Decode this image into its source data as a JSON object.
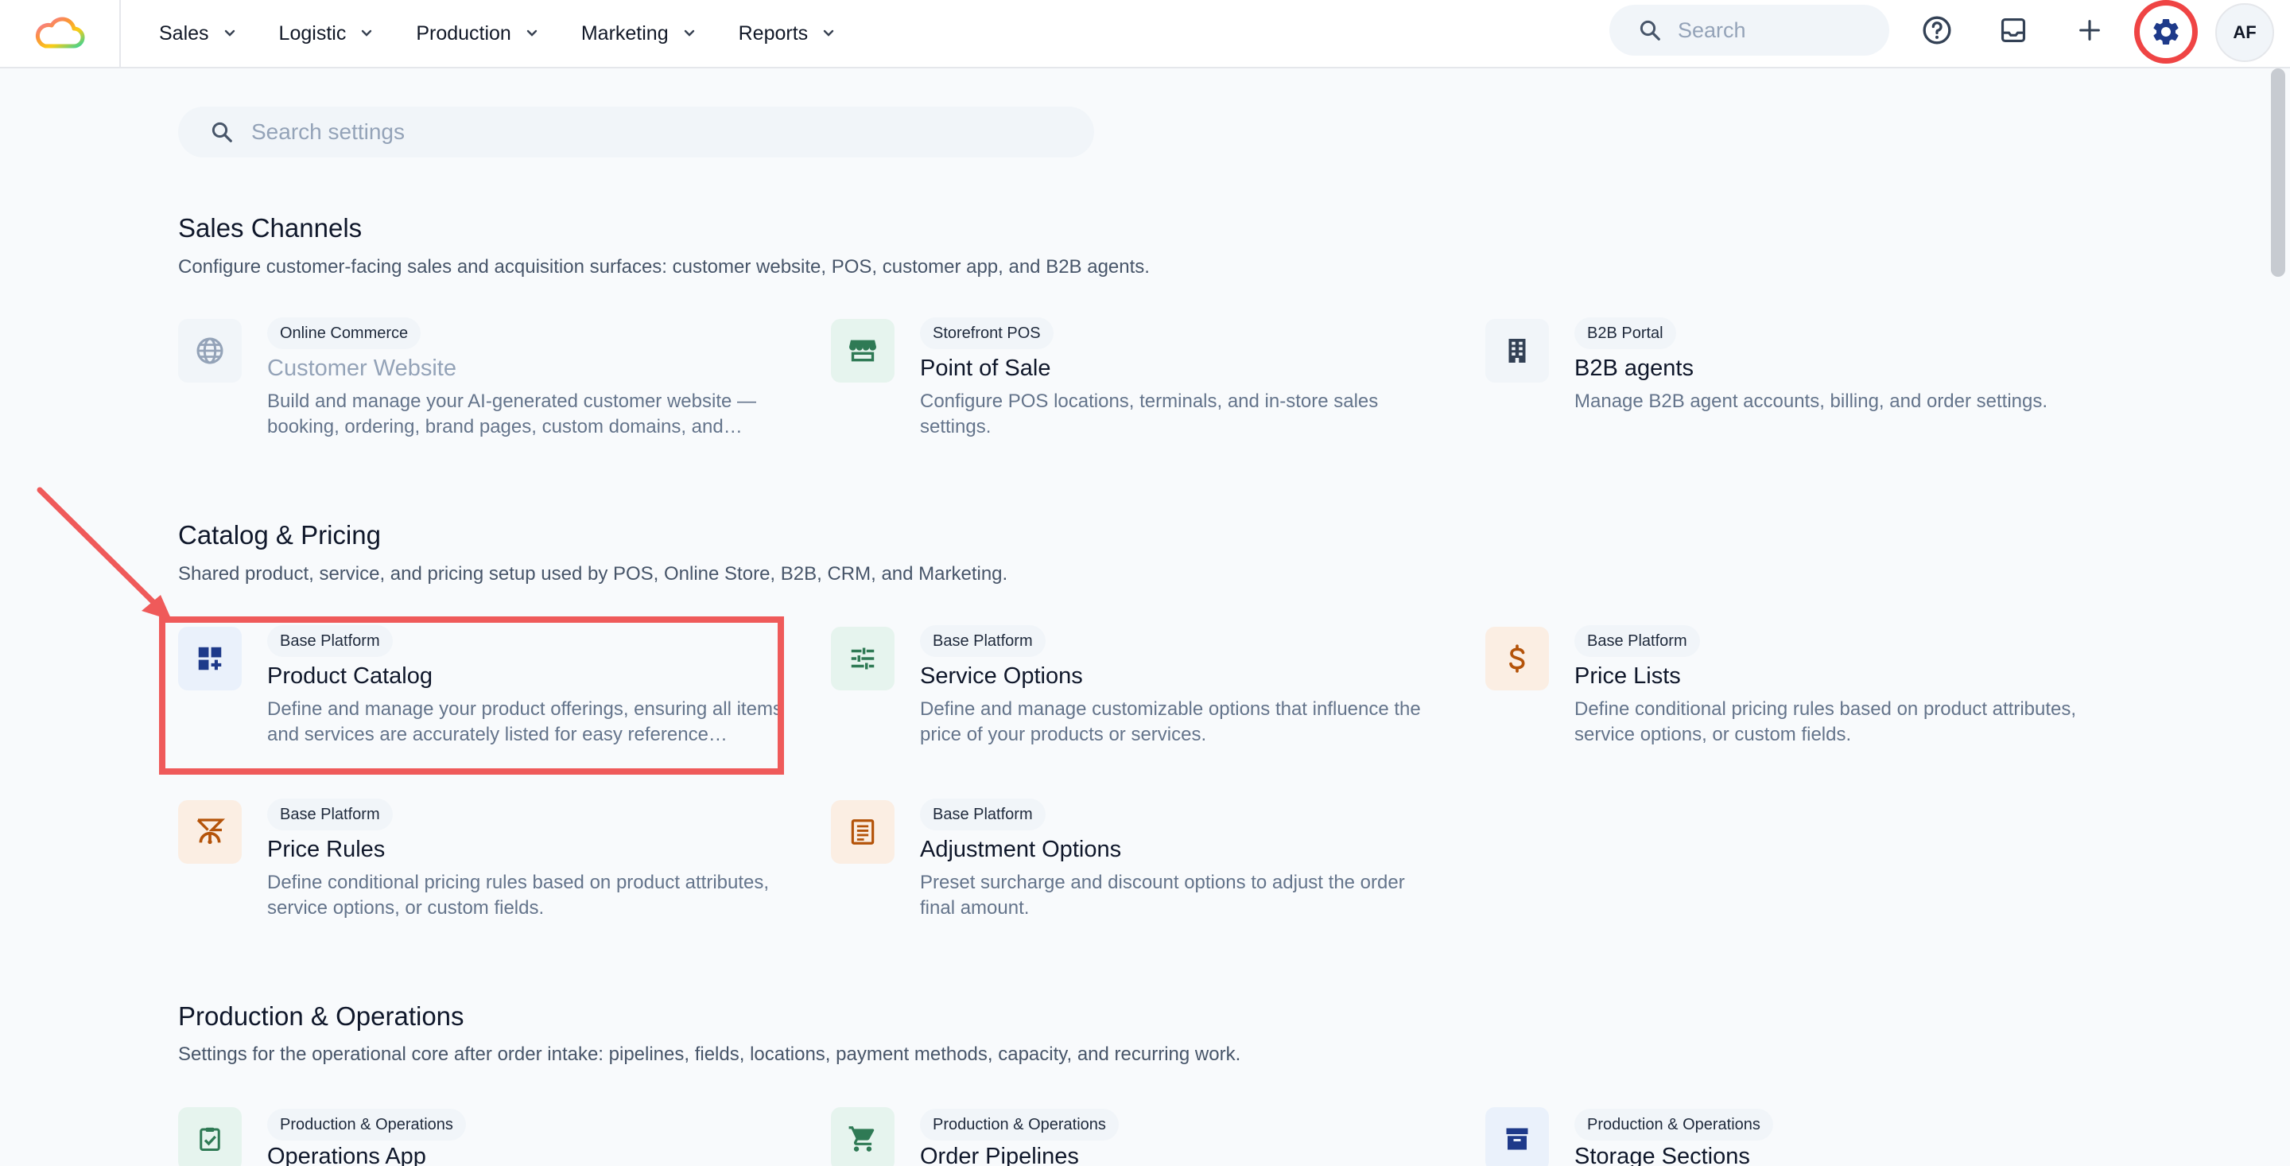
{
  "brand": {
    "logo_name": "cloud-logo"
  },
  "nav": {
    "items": [
      {
        "label": "Sales"
      },
      {
        "label": "Logistic"
      },
      {
        "label": "Production"
      },
      {
        "label": "Marketing"
      },
      {
        "label": "Reports"
      }
    ]
  },
  "header": {
    "search_placeholder": "Search",
    "avatar_initials": "AF",
    "icons": [
      "help-circle-icon",
      "inbox-icon",
      "plus-icon",
      "gear-icon"
    ]
  },
  "settings_search": {
    "placeholder": "Search settings"
  },
  "sections": [
    {
      "title": "Sales Channels",
      "description": "Configure customer-facing sales and acquisition surfaces: customer website, POS, customer app, and B2B agents.",
      "cards": [
        {
          "badge": "Online Commerce",
          "title": "Customer Website",
          "description": "Build and manage your AI-generated customer website — booking, ordering, brand pages, custom domains, and…",
          "icon": "globe-icon",
          "disabled": true
        },
        {
          "badge": "Storefront POS",
          "title": "Point of Sale",
          "description": "Configure POS locations, terminals, and in-store sales settings.",
          "icon": "storefront-icon"
        },
        {
          "badge": "B2B Portal",
          "title": "B2B agents",
          "description": "Manage B2B agent accounts, billing, and order settings.",
          "icon": "building-icon"
        }
      ]
    },
    {
      "title": "Catalog & Pricing",
      "description": "Shared product, service, and pricing setup used by POS, Online Store, B2B, CRM, and Marketing.",
      "cards": [
        {
          "badge": "Base Platform",
          "title": "Product Catalog",
          "description": "Define and manage your product offerings, ensuring all items and services are accurately listed for easy reference…",
          "icon": "dashboard-add-icon"
        },
        {
          "badge": "Base Platform",
          "title": "Service Options",
          "description": "Define and manage customizable options that influence the price of your products or services.",
          "icon": "sliders-icon"
        },
        {
          "badge": "Base Platform",
          "title": "Price Lists",
          "description": "Define conditional pricing rules based on product attributes, service options, or custom fields.",
          "icon": "dollar-icon"
        },
        {
          "badge": "Base Platform",
          "title": "Price Rules",
          "description": "Define conditional pricing rules based on product attributes, service options, or custom fields.",
          "icon": "price-rule-icon"
        },
        {
          "badge": "Base Platform",
          "title": "Adjustment Options",
          "description": "Preset surcharge and discount options to adjust the order final amount.",
          "icon": "receipt-icon"
        }
      ]
    },
    {
      "title": "Production & Operations",
      "description": "Settings for the operational core after order intake: pipelines, fields, locations, payment methods, capacity, and recurring work.",
      "cards": [
        {
          "badge": "Production & Operations",
          "title": "Operations App",
          "icon": "clipboard-check-icon"
        },
        {
          "badge": "Production & Operations",
          "title": "Order Pipelines",
          "icon": "cart-icon"
        },
        {
          "badge": "Production & Operations",
          "title": "Storage Sections",
          "icon": "archive-icon"
        }
      ]
    }
  ],
  "colors": {
    "accent_red": "#ef4444",
    "green_icon": "#2f7a55",
    "navy_icon": "#1e3a8a",
    "orange_icon": "#b45309"
  }
}
